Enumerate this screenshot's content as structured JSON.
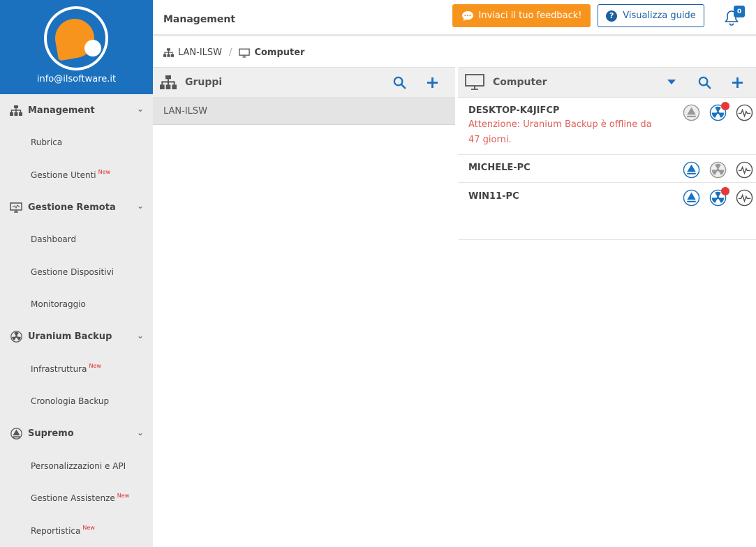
{
  "sidebar": {
    "email": "info@ilsoftware.it",
    "sections": [
      {
        "label": "Management",
        "icon": "sitemap-icon",
        "items": [
          {
            "label": "Rubrica",
            "new": ""
          },
          {
            "label": "Gestione Utenti",
            "new": "New"
          }
        ]
      },
      {
        "label": "Gestione Remota",
        "icon": "monitor-icon",
        "items": [
          {
            "label": "Dashboard",
            "new": ""
          },
          {
            "label": "Gestione Dispositivi",
            "new": ""
          },
          {
            "label": "Monitoraggio",
            "new": ""
          }
        ]
      },
      {
        "label": "Uranium Backup",
        "icon": "radiation-icon",
        "items": [
          {
            "label": "Infrastruttura",
            "new": "New"
          },
          {
            "label": "Cronologia Backup",
            "new": ""
          }
        ]
      },
      {
        "label": "Supremo",
        "icon": "supremo-icon",
        "items": [
          {
            "label": "Personalizzazioni e API",
            "new": ""
          },
          {
            "label": "Gestione Assistenze",
            "new": "New"
          },
          {
            "label": "Reportistica",
            "new": "New"
          }
        ]
      }
    ]
  },
  "header": {
    "title": "Management",
    "feedback_label": "Inviaci il tuo feedback!",
    "guide_label": "Visualizza guide",
    "notifications_count": "0"
  },
  "breadcrumb": {
    "root": "LAN-ILSW",
    "current": "Computer"
  },
  "groups_panel": {
    "title": "Gruppi",
    "rows": [
      "LAN-ILSW"
    ]
  },
  "computers_panel": {
    "title": "Computer",
    "rows": [
      {
        "name": "DESKTOP-K4JIFCP",
        "warning": "Attenzione: Uranium Backup è offline da 47 giorni.",
        "supremo_active": false,
        "uranium_alert": true
      },
      {
        "name": "MICHELE-PC",
        "warning": "",
        "supremo_active": true,
        "uranium_alert": false
      },
      {
        "name": "WIN11-PC",
        "warning": "",
        "supremo_active": true,
        "uranium_alert": true
      }
    ]
  },
  "colors": {
    "brand_blue": "#1c71bf",
    "accent_orange": "#f7941d",
    "warning_red": "#e0605a",
    "alert_dot": "#e53935"
  }
}
